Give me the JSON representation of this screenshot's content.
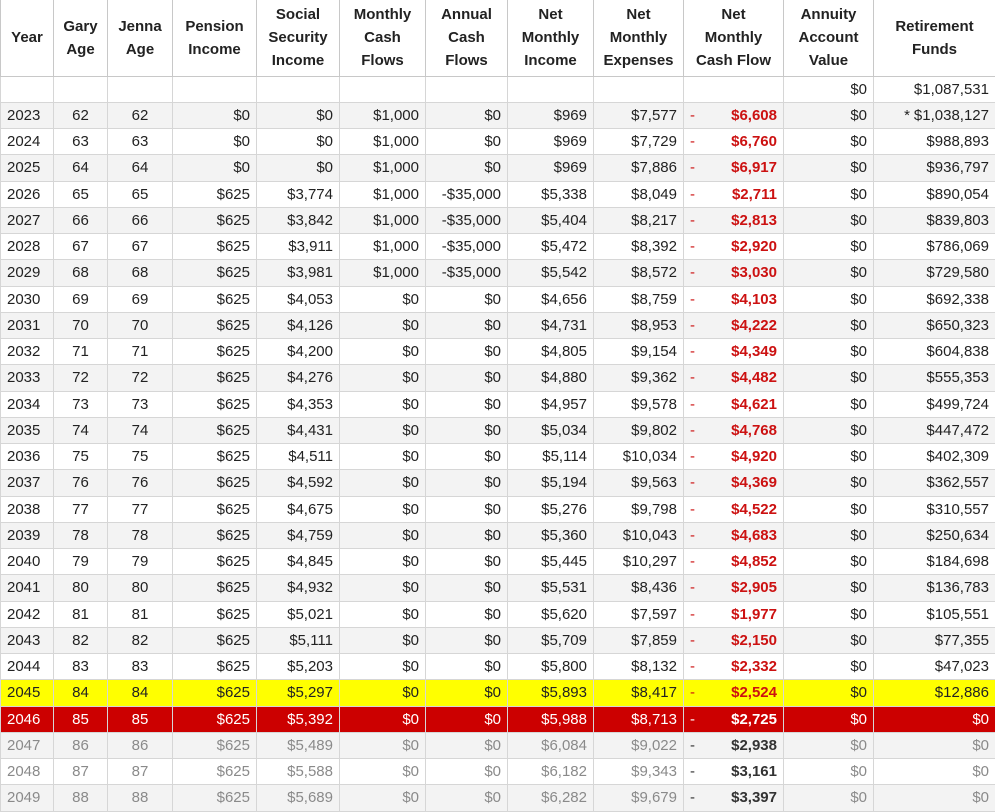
{
  "headers": [
    "Year",
    "Gary Age",
    "Jenna Age",
    "Pension Income",
    "Social Security Income",
    "Monthly Cash Flows",
    "Annual Cash Flows",
    "Net Monthly Income",
    "Net Monthly Expenses",
    "Net Monthly Cash Flow",
    "Annuity Account Value",
    "Retirement Funds"
  ],
  "header_lines": [
    [
      "Year"
    ],
    [
      "Gary",
      "Age"
    ],
    [
      "Jenna",
      "Age"
    ],
    [
      "Pension",
      "Income"
    ],
    [
      "Social",
      "Security",
      "Income"
    ],
    [
      "Monthly",
      "Cash",
      "Flows"
    ],
    [
      "Annual",
      "Cash",
      "Flows"
    ],
    [
      "Net",
      "Monthly",
      "Income"
    ],
    [
      "Net",
      "Monthly",
      "Expenses"
    ],
    [
      "Net",
      "Monthly",
      "Cash Flow"
    ],
    [
      "Annuity",
      "Account",
      "Value"
    ],
    [
      "Retirement",
      "Funds"
    ]
  ],
  "initial_row": {
    "annuity": "$0",
    "retirement": "$1,087,531"
  },
  "rows": [
    {
      "year": "2023",
      "gary": "62",
      "jenna": "62",
      "pension": "$0",
      "ss": "$0",
      "mcf": "$1,000",
      "acf": "$0",
      "income": "$969",
      "expenses": "$7,577",
      "net": "$6,608",
      "annuity": "$0",
      "retirement": "$1,038,127",
      "star": "*",
      "style": ""
    },
    {
      "year": "2024",
      "gary": "63",
      "jenna": "63",
      "pension": "$0",
      "ss": "$0",
      "mcf": "$1,000",
      "acf": "$0",
      "income": "$969",
      "expenses": "$7,729",
      "net": "$6,760",
      "annuity": "$0",
      "retirement": "$988,893",
      "star": "",
      "style": ""
    },
    {
      "year": "2025",
      "gary": "64",
      "jenna": "64",
      "pension": "$0",
      "ss": "$0",
      "mcf": "$1,000",
      "acf": "$0",
      "income": "$969",
      "expenses": "$7,886",
      "net": "$6,917",
      "annuity": "$0",
      "retirement": "$936,797",
      "star": "",
      "style": ""
    },
    {
      "year": "2026",
      "gary": "65",
      "jenna": "65",
      "pension": "$625",
      "ss": "$3,774",
      "mcf": "$1,000",
      "acf": "-$35,000",
      "income": "$5,338",
      "expenses": "$8,049",
      "net": "$2,711",
      "annuity": "$0",
      "retirement": "$890,054",
      "star": "",
      "style": ""
    },
    {
      "year": "2027",
      "gary": "66",
      "jenna": "66",
      "pension": "$625",
      "ss": "$3,842",
      "mcf": "$1,000",
      "acf": "-$35,000",
      "income": "$5,404",
      "expenses": "$8,217",
      "net": "$2,813",
      "annuity": "$0",
      "retirement": "$839,803",
      "star": "",
      "style": ""
    },
    {
      "year": "2028",
      "gary": "67",
      "jenna": "67",
      "pension": "$625",
      "ss": "$3,911",
      "mcf": "$1,000",
      "acf": "-$35,000",
      "income": "$5,472",
      "expenses": "$8,392",
      "net": "$2,920",
      "annuity": "$0",
      "retirement": "$786,069",
      "star": "",
      "style": ""
    },
    {
      "year": "2029",
      "gary": "68",
      "jenna": "68",
      "pension": "$625",
      "ss": "$3,981",
      "mcf": "$1,000",
      "acf": "-$35,000",
      "income": "$5,542",
      "expenses": "$8,572",
      "net": "$3,030",
      "annuity": "$0",
      "retirement": "$729,580",
      "star": "",
      "style": ""
    },
    {
      "year": "2030",
      "gary": "69",
      "jenna": "69",
      "pension": "$625",
      "ss": "$4,053",
      "mcf": "$0",
      "acf": "$0",
      "income": "$4,656",
      "expenses": "$8,759",
      "net": "$4,103",
      "annuity": "$0",
      "retirement": "$692,338",
      "star": "",
      "style": ""
    },
    {
      "year": "2031",
      "gary": "70",
      "jenna": "70",
      "pension": "$625",
      "ss": "$4,126",
      "mcf": "$0",
      "acf": "$0",
      "income": "$4,731",
      "expenses": "$8,953",
      "net": "$4,222",
      "annuity": "$0",
      "retirement": "$650,323",
      "star": "",
      "style": ""
    },
    {
      "year": "2032",
      "gary": "71",
      "jenna": "71",
      "pension": "$625",
      "ss": "$4,200",
      "mcf": "$0",
      "acf": "$0",
      "income": "$4,805",
      "expenses": "$9,154",
      "net": "$4,349",
      "annuity": "$0",
      "retirement": "$604,838",
      "star": "",
      "style": ""
    },
    {
      "year": "2033",
      "gary": "72",
      "jenna": "72",
      "pension": "$625",
      "ss": "$4,276",
      "mcf": "$0",
      "acf": "$0",
      "income": "$4,880",
      "expenses": "$9,362",
      "net": "$4,482",
      "annuity": "$0",
      "retirement": "$555,353",
      "star": "",
      "style": ""
    },
    {
      "year": "2034",
      "gary": "73",
      "jenna": "73",
      "pension": "$625",
      "ss": "$4,353",
      "mcf": "$0",
      "acf": "$0",
      "income": "$4,957",
      "expenses": "$9,578",
      "net": "$4,621",
      "annuity": "$0",
      "retirement": "$499,724",
      "star": "",
      "style": ""
    },
    {
      "year": "2035",
      "gary": "74",
      "jenna": "74",
      "pension": "$625",
      "ss": "$4,431",
      "mcf": "$0",
      "acf": "$0",
      "income": "$5,034",
      "expenses": "$9,802",
      "net": "$4,768",
      "annuity": "$0",
      "retirement": "$447,472",
      "star": "",
      "style": ""
    },
    {
      "year": "2036",
      "gary": "75",
      "jenna": "75",
      "pension": "$625",
      "ss": "$4,511",
      "mcf": "$0",
      "acf": "$0",
      "income": "$5,114",
      "expenses": "$10,034",
      "net": "$4,920",
      "annuity": "$0",
      "retirement": "$402,309",
      "star": "",
      "style": ""
    },
    {
      "year": "2037",
      "gary": "76",
      "jenna": "76",
      "pension": "$625",
      "ss": "$4,592",
      "mcf": "$0",
      "acf": "$0",
      "income": "$5,194",
      "expenses": "$9,563",
      "net": "$4,369",
      "annuity": "$0",
      "retirement": "$362,557",
      "star": "",
      "style": ""
    },
    {
      "year": "2038",
      "gary": "77",
      "jenna": "77",
      "pension": "$625",
      "ss": "$4,675",
      "mcf": "$0",
      "acf": "$0",
      "income": "$5,276",
      "expenses": "$9,798",
      "net": "$4,522",
      "annuity": "$0",
      "retirement": "$310,557",
      "star": "",
      "style": ""
    },
    {
      "year": "2039",
      "gary": "78",
      "jenna": "78",
      "pension": "$625",
      "ss": "$4,759",
      "mcf": "$0",
      "acf": "$0",
      "income": "$5,360",
      "expenses": "$10,043",
      "net": "$4,683",
      "annuity": "$0",
      "retirement": "$250,634",
      "star": "",
      "style": ""
    },
    {
      "year": "2040",
      "gary": "79",
      "jenna": "79",
      "pension": "$625",
      "ss": "$4,845",
      "mcf": "$0",
      "acf": "$0",
      "income": "$5,445",
      "expenses": "$10,297",
      "net": "$4,852",
      "annuity": "$0",
      "retirement": "$184,698",
      "star": "",
      "style": ""
    },
    {
      "year": "2041",
      "gary": "80",
      "jenna": "80",
      "pension": "$625",
      "ss": "$4,932",
      "mcf": "$0",
      "acf": "$0",
      "income": "$5,531",
      "expenses": "$8,436",
      "net": "$2,905",
      "annuity": "$0",
      "retirement": "$136,783",
      "star": "",
      "style": ""
    },
    {
      "year": "2042",
      "gary": "81",
      "jenna": "81",
      "pension": "$625",
      "ss": "$5,021",
      "mcf": "$0",
      "acf": "$0",
      "income": "$5,620",
      "expenses": "$7,597",
      "net": "$1,977",
      "annuity": "$0",
      "retirement": "$105,551",
      "star": "",
      "style": ""
    },
    {
      "year": "2043",
      "gary": "82",
      "jenna": "82",
      "pension": "$625",
      "ss": "$5,111",
      "mcf": "$0",
      "acf": "$0",
      "income": "$5,709",
      "expenses": "$7,859",
      "net": "$2,150",
      "annuity": "$0",
      "retirement": "$77,355",
      "star": "",
      "style": ""
    },
    {
      "year": "2044",
      "gary": "83",
      "jenna": "83",
      "pension": "$625",
      "ss": "$5,203",
      "mcf": "$0",
      "acf": "$0",
      "income": "$5,800",
      "expenses": "$8,132",
      "net": "$2,332",
      "annuity": "$0",
      "retirement": "$47,023",
      "star": "",
      "style": ""
    },
    {
      "year": "2045",
      "gary": "84",
      "jenna": "84",
      "pension": "$625",
      "ss": "$5,297",
      "mcf": "$0",
      "acf": "$0",
      "income": "$5,893",
      "expenses": "$8,417",
      "net": "$2,524",
      "annuity": "$0",
      "retirement": "$12,886",
      "star": "",
      "style": "hl-yellow"
    },
    {
      "year": "2046",
      "gary": "85",
      "jenna": "85",
      "pension": "$625",
      "ss": "$5,392",
      "mcf": "$0",
      "acf": "$0",
      "income": "$5,988",
      "expenses": "$8,713",
      "net": "$2,725",
      "annuity": "$0",
      "retirement": "$0",
      "star": "",
      "style": "hl-red"
    },
    {
      "year": "2047",
      "gary": "86",
      "jenna": "86",
      "pension": "$625",
      "ss": "$5,489",
      "mcf": "$0",
      "acf": "$0",
      "income": "$6,084",
      "expenses": "$9,022",
      "net": "$2,938",
      "annuity": "$0",
      "retirement": "$0",
      "star": "",
      "style": "future"
    },
    {
      "year": "2048",
      "gary": "87",
      "jenna": "87",
      "pension": "$625",
      "ss": "$5,588",
      "mcf": "$0",
      "acf": "$0",
      "income": "$6,182",
      "expenses": "$9,343",
      "net": "$3,161",
      "annuity": "$0",
      "retirement": "$0",
      "star": "",
      "style": "future"
    },
    {
      "year": "2049",
      "gary": "88",
      "jenna": "88",
      "pension": "$625",
      "ss": "$5,689",
      "mcf": "$0",
      "acf": "$0",
      "income": "$6,282",
      "expenses": "$9,679",
      "net": "$3,397",
      "annuity": "$0",
      "retirement": "$0",
      "star": "",
      "style": "future"
    }
  ],
  "colors": {
    "negative_text": "#cc1111",
    "highlight_yellow": "#ffff00",
    "highlight_red": "#cc0000",
    "future_text": "#8a8a8a"
  }
}
